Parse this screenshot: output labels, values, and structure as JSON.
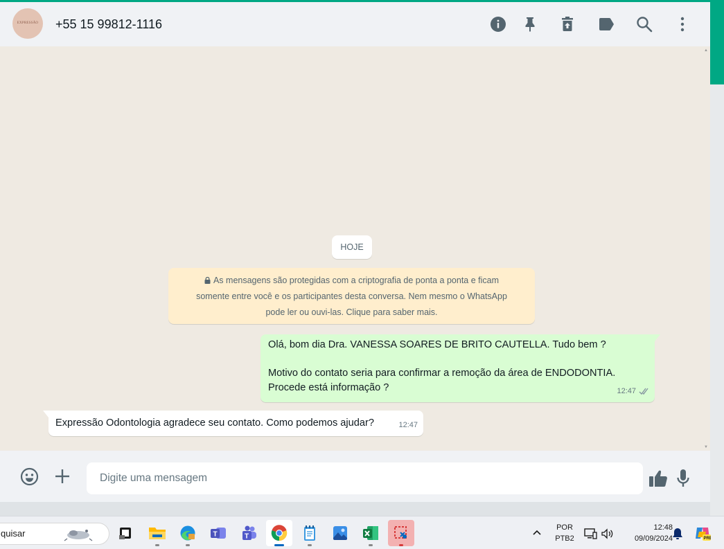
{
  "header": {
    "avatar_text": "EXPRESSÃO",
    "contact_name": "+55 15 99812-1116",
    "icons": [
      "info-icon",
      "pin-icon",
      "delete-icon",
      "label-icon",
      "search-icon",
      "menu-icon"
    ]
  },
  "chat": {
    "date_chip": "HOJE",
    "encryption_notice": {
      "line1": "As mensagens são protegidas com a criptografia de ponta a ponta e ficam",
      "line2": "somente entre você e os participantes desta conversa. Nem mesmo o WhatsApp",
      "line3": "pode ler ou ouvi-las. Clique para saber mais."
    },
    "outgoing_message": {
      "line1": "Olá, bom dia Dra. VANESSA SOARES DE BRITO CAUTELLA. Tudo bem ?",
      "line2": "Motivo do contato seria para confirmar a remoção da área de ENDODONTIA.",
      "line3": "Procede está informação ?",
      "time": "12:47",
      "status": "read"
    },
    "incoming_message": {
      "text": "Expressão Odontologia agradece seu contato. Como podemos ajudar?",
      "time": "12:47"
    }
  },
  "composer": {
    "placeholder": "Digite uma mensagem",
    "icons": [
      "emoji-icon",
      "plus-icon",
      "thumbs-up-icon",
      "microphone-icon"
    ]
  },
  "taskbar": {
    "search_text": "quisar",
    "apps": [
      "task-view",
      "file-explorer",
      "edge",
      "teams-classic",
      "teams",
      "chrome",
      "notepad",
      "photos",
      "excel",
      "snipping-tool"
    ],
    "language_line1": "POR",
    "language_line2": "PTB2",
    "time": "12:48",
    "date": "09/09/2024"
  },
  "colors": {
    "accent": "#00a884",
    "outgoing_bubble": "#d9fdd3",
    "incoming_bubble": "#ffffff",
    "notice_bg": "#ffeecd",
    "chat_bg": "#efeae2",
    "read_tick": "#53bdeb"
  }
}
